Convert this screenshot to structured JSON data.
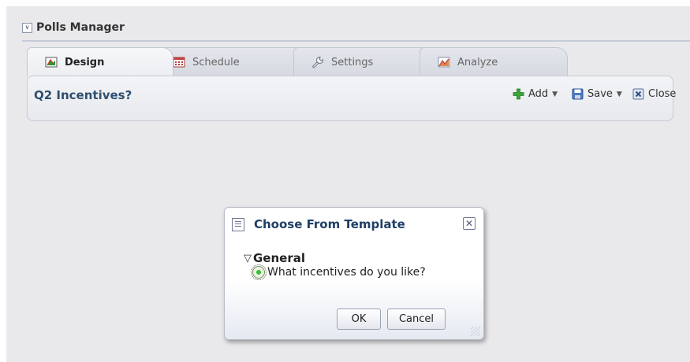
{
  "header": {
    "title": "Polls Manager"
  },
  "tabs": [
    {
      "label": "Design",
      "icon": "design-icon",
      "active": true
    },
    {
      "label": "Schedule",
      "icon": "calendar-icon",
      "active": false
    },
    {
      "label": "Settings",
      "icon": "wrench-icon",
      "active": false
    },
    {
      "label": "Analyze",
      "icon": "chart-icon",
      "active": false
    }
  ],
  "toolbar": {
    "poll_title": "Q2 Incentives?",
    "add_label": "Add",
    "save_label": "Save",
    "close_label": "Close"
  },
  "dialog": {
    "title": "Choose From Template",
    "group": "General",
    "item": "What incentives do you like?",
    "ok_label": "OK",
    "cancel_label": "Cancel"
  },
  "colors": {
    "accent_title": "#2f4f6f",
    "add_green": "#3aa63a",
    "save_blue": "#4a78c0"
  }
}
